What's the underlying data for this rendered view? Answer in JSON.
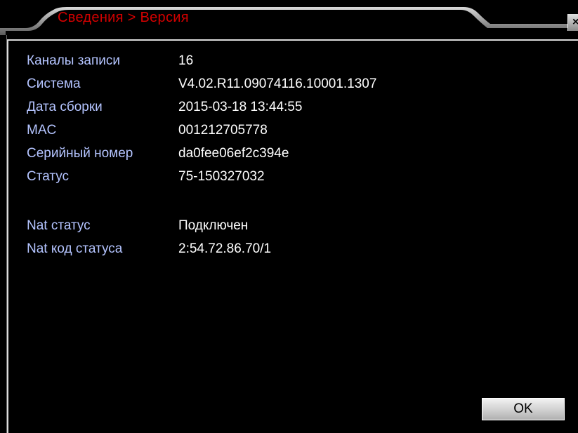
{
  "window": {
    "title": "Сведения > Версия",
    "close_label": "×"
  },
  "info": {
    "rows": [
      {
        "label": "Каналы записи",
        "value": "16"
      },
      {
        "label": "Система",
        "value": "V4.02.R11.09074116.10001.1307"
      },
      {
        "label": "Дата сборки",
        "value": "2015-03-18 13:44:55"
      },
      {
        "label": "MAC",
        "value": "001212705778"
      },
      {
        "label": "Серийный номер",
        "value": "da0fee06ef2c394e"
      },
      {
        "label": "Статус",
        "value": "75-150327032"
      },
      {
        "label": "Nat статус",
        "value": "Подключен"
      },
      {
        "label": "Nat код статуса",
        "value": "2:54.72.86.70/1"
      }
    ]
  },
  "buttons": {
    "ok_label": "OK"
  },
  "colors": {
    "title": "#d40000",
    "label": "#b4c4ff",
    "value": "#ffffff",
    "background": "#000000"
  }
}
